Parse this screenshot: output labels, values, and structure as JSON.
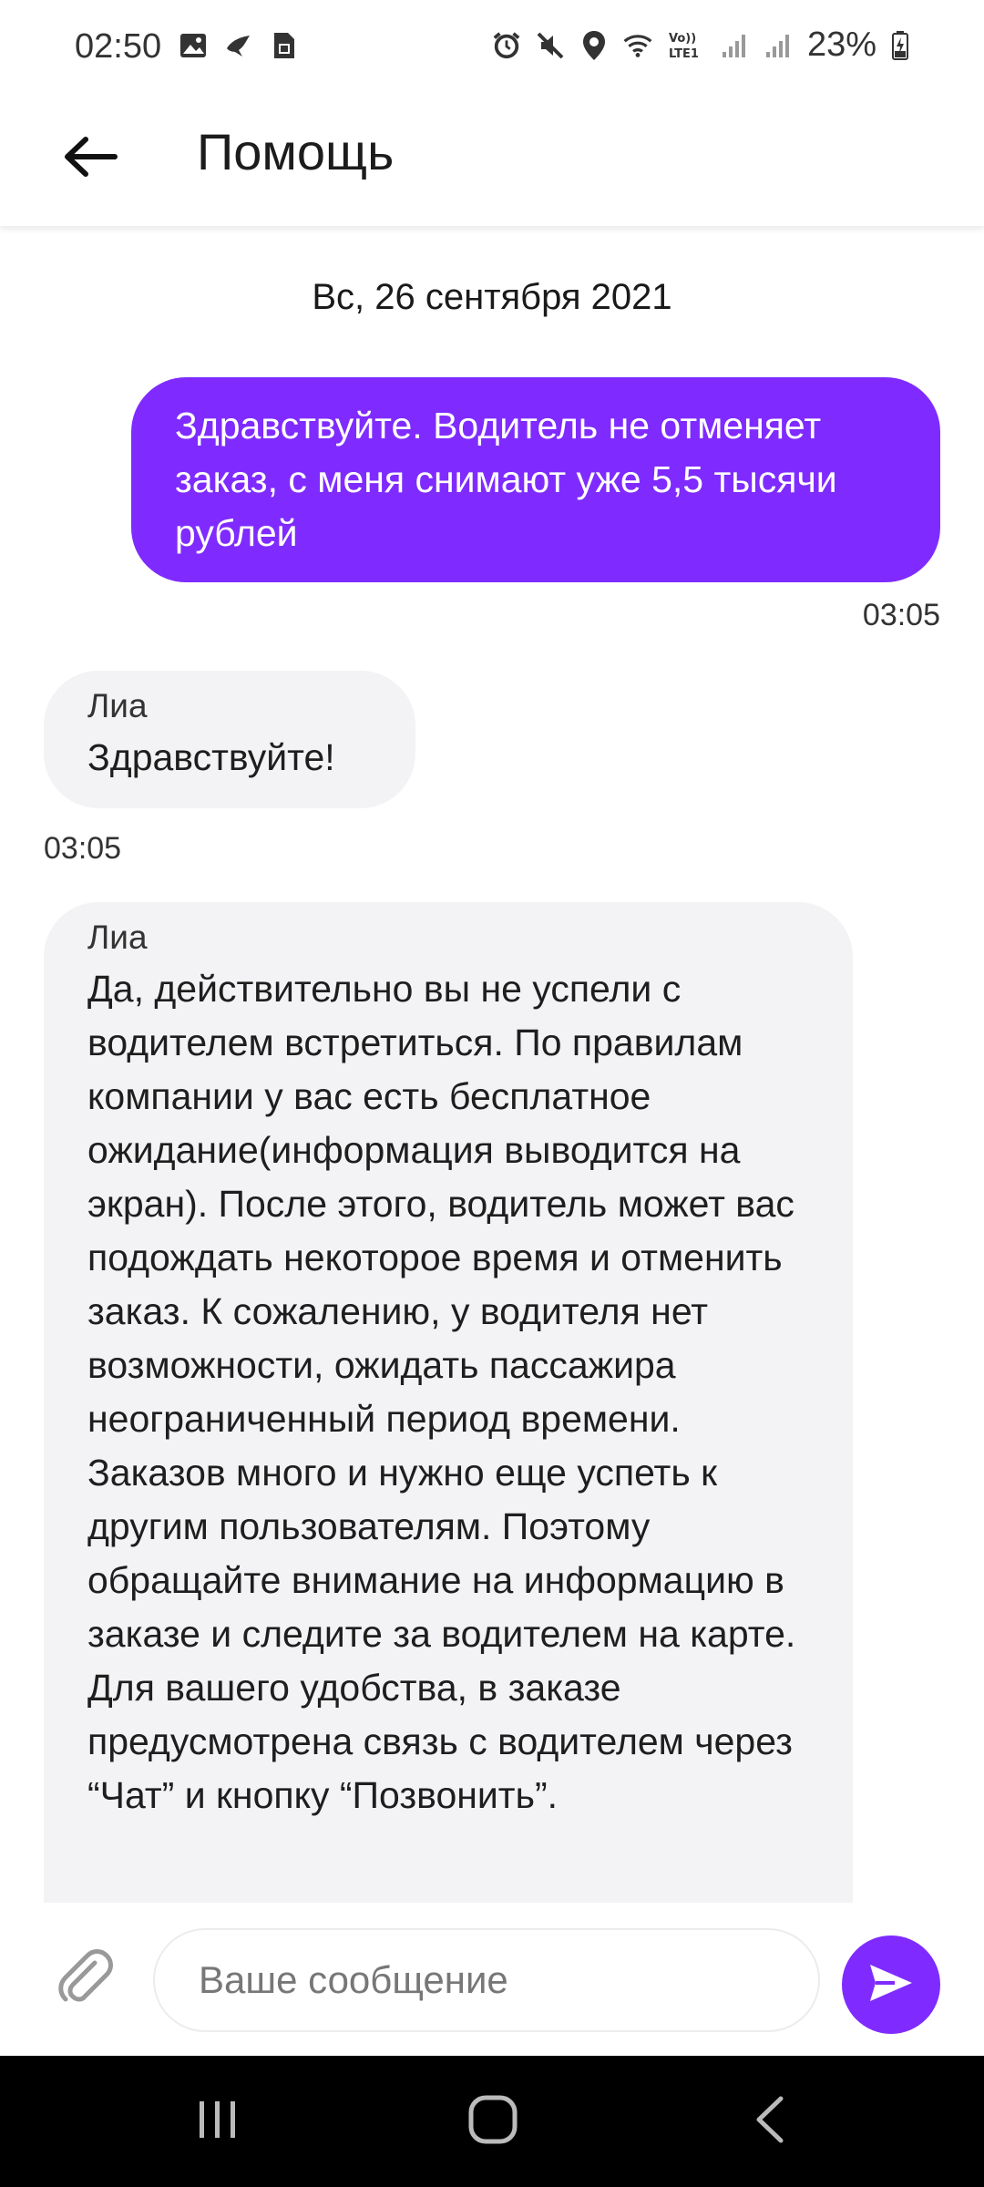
{
  "status_bar": {
    "time": "02:50",
    "battery": "23%",
    "left_icons": [
      "image-icon",
      "bird-icon",
      "sim-card-icon"
    ],
    "right_icons": [
      "alarm-icon",
      "mute-icon",
      "location-icon",
      "wifi-icon",
      "lte-icon",
      "signal-icon",
      "signal-icon",
      "battery-charging-icon"
    ],
    "volte_label": "Vo)) LTE1"
  },
  "app_bar": {
    "title": "Помощь",
    "back_icon": "arrow-left-icon"
  },
  "chat": {
    "date_separator": "Вс, 26 сентября 2021",
    "messages": [
      {
        "direction": "out",
        "text": "Здравствуйте. Водитель не отменяет заказ, с меня снимают уже 5,5 тысячи рублей",
        "time": "03:05"
      },
      {
        "direction": "in",
        "sender": "Лиа",
        "text": "Здравствуйте!",
        "time": "03:05"
      },
      {
        "direction": "in",
        "sender": "Лиа",
        "text": "Да, действительно вы не успели с водителем встретиться. По правилам компании у вас есть бесплатное ожидание(информация выводится на экран). После этого, водитель может вас подождать некоторое время и отменить заказ. К сожалению, у водителя нет возможности, ожидать пассажира неограниченный период времени. Заказов много и нужно еще успеть к другим пользователям. Поэтому обращайте внимание на информацию в заказе и следите за водителем на карте. Для вашего удобства, в заказе предусмотрена связь с водителем через “Чат” и кнопку “Позвонить”."
      }
    ]
  },
  "input_bar": {
    "placeholder": "Ваше сообщение",
    "attach_icon": "paperclip-icon",
    "send_icon": "send-icon"
  },
  "colors": {
    "accent": "#7F2BFF",
    "incoming_bubble": "#F3F3F5",
    "nav_bar": "#000000"
  }
}
